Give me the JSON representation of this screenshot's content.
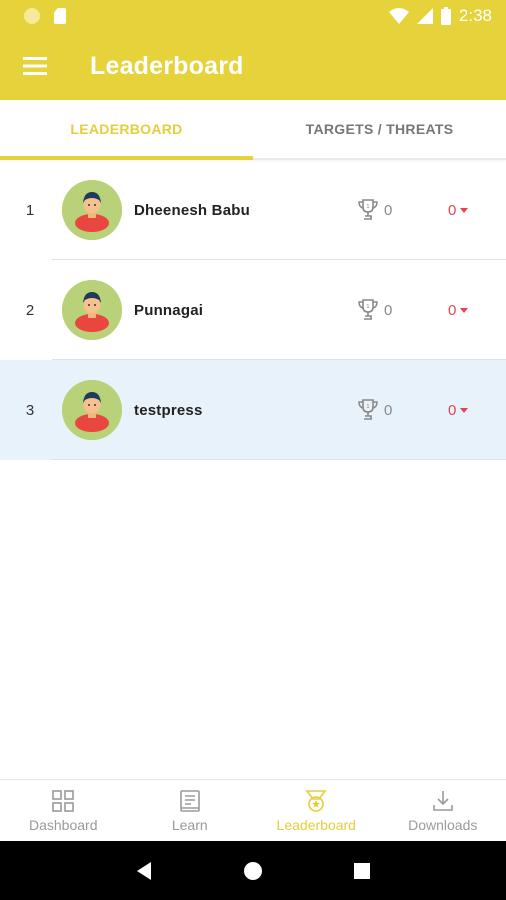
{
  "status_bar": {
    "time": "2:38"
  },
  "app_bar": {
    "title": "Leaderboard",
    "menu_icon": "hamburger-menu-icon"
  },
  "tabs": [
    {
      "label": "LEADERBOARD",
      "active": true
    },
    {
      "label": "TARGETS / THREATS",
      "active": false
    }
  ],
  "leaderboard": [
    {
      "rank": "1",
      "name": "Dheenesh Babu",
      "trophies": "0",
      "delta": "0",
      "highlight": false
    },
    {
      "rank": "2",
      "name": "Punnagai",
      "trophies": "0",
      "delta": "0",
      "highlight": false
    },
    {
      "rank": "3",
      "name": "testpress",
      "trophies": "0",
      "delta": "0",
      "highlight": true
    }
  ],
  "bottom_nav": [
    {
      "label": "Dashboard",
      "icon": "dashboard-grid-icon",
      "active": false
    },
    {
      "label": "Learn",
      "icon": "book-icon",
      "active": false
    },
    {
      "label": "Leaderboard",
      "icon": "medal-icon",
      "active": true
    },
    {
      "label": "Downloads",
      "icon": "download-icon",
      "active": false
    }
  ],
  "colors": {
    "primary": "#e6d23a",
    "active_text": "#e3cf3c",
    "negative": "#e2454f",
    "highlight_row": "#e8f2fb"
  }
}
